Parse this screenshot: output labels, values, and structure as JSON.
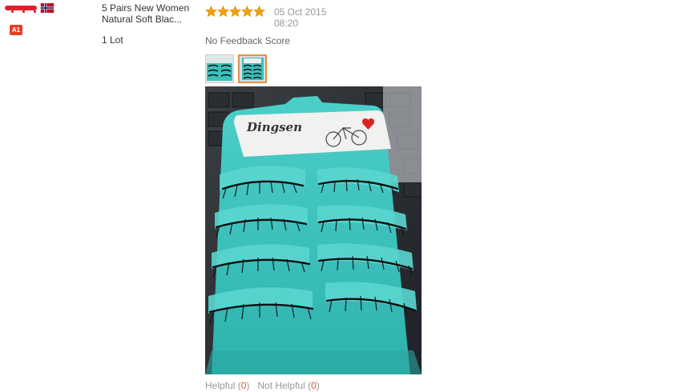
{
  "buyer": {
    "level_badge": "A1",
    "flag_icon": "flag-norway-icon"
  },
  "product": {
    "title": "5 Pairs New Women Natural Soft Blac...",
    "quantity": "1 Lot"
  },
  "review": {
    "rating": 5,
    "date": "05 Oct 2015 08:20",
    "feedback_score": "No Feedback Score",
    "photo_brand_text": "Dingsen",
    "helpful_label": "Helpful",
    "helpful_open": "(",
    "helpful_count": "0",
    "helpful_close": ")",
    "not_helpful_label": "Not Helpful",
    "not_helpful_open": "(",
    "not_helpful_count": "0",
    "not_helpful_close": ")"
  },
  "colors": {
    "star": "#f5a000",
    "accent_count": "#e05a2a",
    "badge": "#e0402a",
    "packaging_teal": "#3bc0bb"
  }
}
